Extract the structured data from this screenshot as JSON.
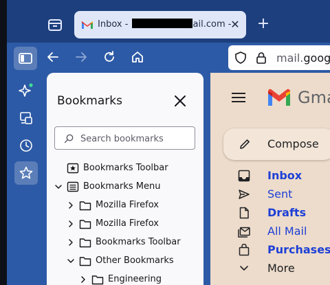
{
  "browser": {
    "tab": {
      "title_prefix": "Inbox - ",
      "title_suffix": "ail.com - ",
      "close_label": "✕"
    },
    "new_tab_label": "+",
    "url": {
      "prefix": "mail.",
      "domain": "google"
    }
  },
  "bookmarks_panel": {
    "title": "Bookmarks",
    "search_placeholder": "Search bookmarks",
    "items": [
      {
        "label": "Bookmarks Toolbar",
        "icon": "star-icon"
      },
      {
        "label": "Bookmarks Menu",
        "icon": "menu-list-icon",
        "expanded": true
      },
      {
        "label": "Mozilla Firefox",
        "icon": "folder-icon"
      },
      {
        "label": "Mozilla Firefox",
        "icon": "folder-icon"
      },
      {
        "label": "Bookmarks Toolbar",
        "icon": "folder-icon"
      },
      {
        "label": "Other Bookmarks",
        "icon": "folder-icon",
        "expanded": true
      },
      {
        "label": "Engineering",
        "icon": "folder-icon"
      }
    ]
  },
  "gmail": {
    "brand": "Gma",
    "compose_label": "Compose",
    "nav": [
      {
        "label": "Inbox",
        "icon": "inbox-icon"
      },
      {
        "label": "Sent",
        "icon": "send-icon"
      },
      {
        "label": "Drafts",
        "icon": "draft-icon"
      },
      {
        "label": "All Mail",
        "icon": "all-mail-icon"
      },
      {
        "label": "Purchases",
        "icon": "shopping-bag-icon"
      },
      {
        "label": "More",
        "icon": "chevron-down-icon"
      }
    ]
  },
  "colors": {
    "accent_blue": "#1d3fd6",
    "toolbar": "#2d5aa6",
    "page_bg": "#eddccb"
  }
}
